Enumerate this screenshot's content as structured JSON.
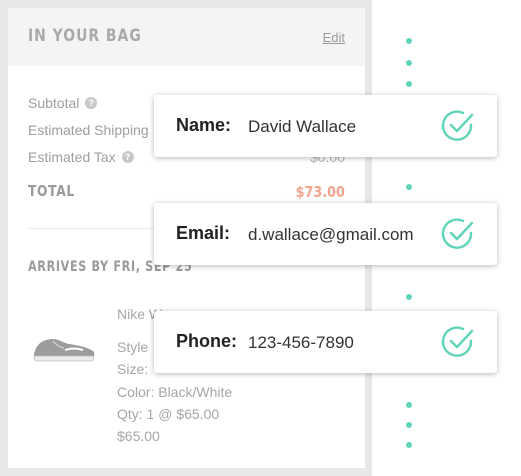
{
  "bag": {
    "title": "IN YOUR BAG",
    "edit_label": "Edit",
    "subtotal_label": "Subtotal",
    "shipping_label": "Estimated Shipping",
    "tax_label": "Estimated Tax",
    "tax_value": "$0.00",
    "total_label": "TOTAL",
    "total_value": "$73.00",
    "arrives_label": "ARRIVES BY FRI, SEP 25",
    "item": {
      "name": "Nike W",
      "style": "Style",
      "size": "Size:",
      "color": "Color: Black/White",
      "qty": "Qty: 1 @ $65.00",
      "price": "$65.00"
    }
  },
  "cards": {
    "name": {
      "label": "Name:",
      "value": "David Wallace"
    },
    "email": {
      "label": "Email:",
      "value": "d.wallace@gmail.com"
    },
    "phone": {
      "label": "Phone:",
      "value": "123-456-7890"
    }
  },
  "colors": {
    "accent": "#5fd4b8",
    "total": "#f2a48c"
  },
  "icons": {
    "help": "question-circle-icon",
    "check": "check-circle-icon",
    "product": "shoe-image"
  }
}
